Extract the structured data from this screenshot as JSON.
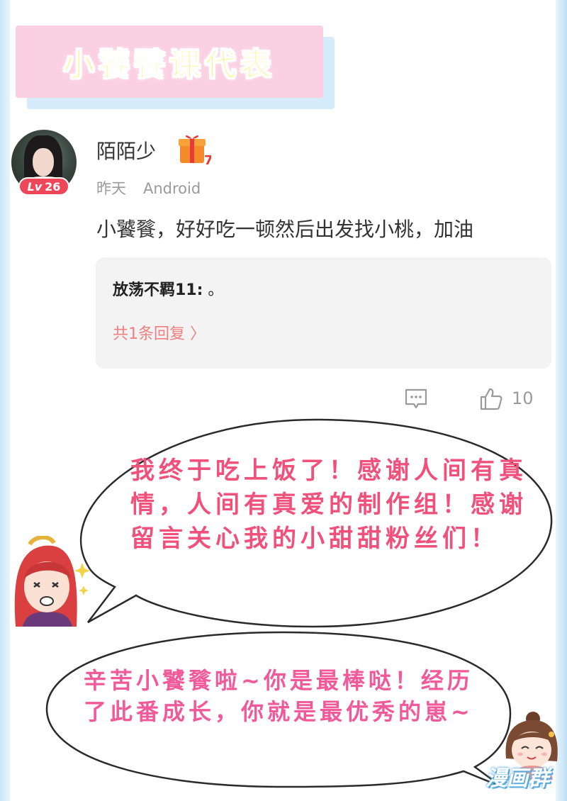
{
  "banner": {
    "title": "小饕餮课代表"
  },
  "post": {
    "user": {
      "name": "陌陌少",
      "level_prefix": "Lv",
      "level": "26",
      "gift_count": "7"
    },
    "meta": {
      "time": "昨天",
      "device": "Android"
    },
    "comment": "小饕餮，好好吃一顿然后出发找小桃，加油",
    "reply": {
      "author": "放荡不羁11:",
      "text": " 。",
      "more": "共1条回复 〉"
    },
    "actions": {
      "like_count": "10"
    }
  },
  "bubbles": {
    "first": "我终于吃上饭了！感谢人间有真情，人间有真爱的制作组！感谢留言关心我的小甜甜粉丝们！",
    "second": "辛苦小饕餮啦~你是最棒哒！经历了此番成长，你就是最优秀的崽~"
  },
  "watermark": "漫画群",
  "colors": {
    "banner_bg": "#fbd0e2",
    "banner_shadow": "#d6ecfa",
    "title_text": "#fff27a",
    "level_badge": "#f0465a",
    "reply_more": "#f08080",
    "bubble1_text": "#f0507a",
    "bubble2_text": "#f05a9a"
  },
  "icons": [
    "gift-icon",
    "comment-icon",
    "like-icon"
  ]
}
